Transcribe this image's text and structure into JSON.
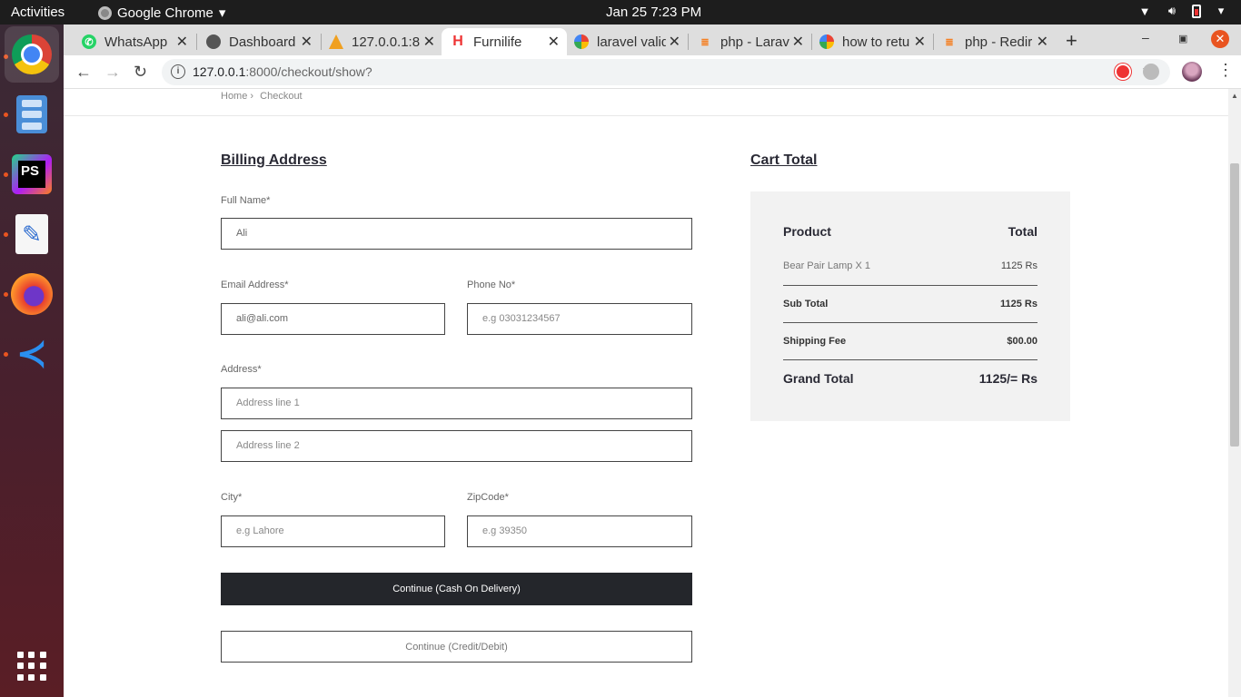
{
  "os": {
    "activities": "Activities",
    "app_menu": "Google Chrome",
    "clock": "Jan 25   7:23 PM"
  },
  "tabs": [
    {
      "title": "WhatsApp",
      "icon": "whatsapp-icon"
    },
    {
      "title": "Dashboard",
      "icon": "dashboard-icon"
    },
    {
      "title": "127.0.0.1:8",
      "icon": "triangle-icon"
    },
    {
      "title": "Furnilife",
      "icon": "furnilife-icon"
    },
    {
      "title": "laravel valid",
      "icon": "google-icon"
    },
    {
      "title": "php - Larav",
      "icon": "stackoverflow-icon"
    },
    {
      "title": "how to retu",
      "icon": "google-icon"
    },
    {
      "title": "php - Redir",
      "icon": "stackoverflow-icon"
    }
  ],
  "browser": {
    "url_host": "127.0.0.1",
    "url_rest": ":8000/checkout/show?"
  },
  "breadcrumb": {
    "home": "Home",
    "separator": "›",
    "current": "Checkout"
  },
  "billing": {
    "title": "Billing Address",
    "full_name_label": "Full Name*",
    "full_name_value": "Ali",
    "email_label": "Email Address*",
    "email_value": "ali@ali.com",
    "phone_label": "Phone No*",
    "phone_placeholder": "e.g 03031234567",
    "address_label": "Address*",
    "address1_placeholder": "Address line 1",
    "address2_placeholder": "Address line 2",
    "city_label": "City*",
    "city_placeholder": "e.g Lahore",
    "zip_label": "ZipCode*",
    "zip_placeholder": "e.g 39350",
    "cod_button": "Continue (Cash On Delivery)",
    "card_button": "Continue (Credit/Debit)"
  },
  "cart": {
    "title": "Cart Total",
    "product_header": "Product",
    "total_header": "Total",
    "items": [
      {
        "name": "Bear Pair Lamp X 1",
        "price": "1125 Rs"
      }
    ],
    "subtotal_label": "Sub Total",
    "subtotal_value": "1125 Rs",
    "shipping_label": "Shipping Fee",
    "shipping_value": "$00.00",
    "grand_label": "Grand Total",
    "grand_value": "1125/= Rs"
  }
}
